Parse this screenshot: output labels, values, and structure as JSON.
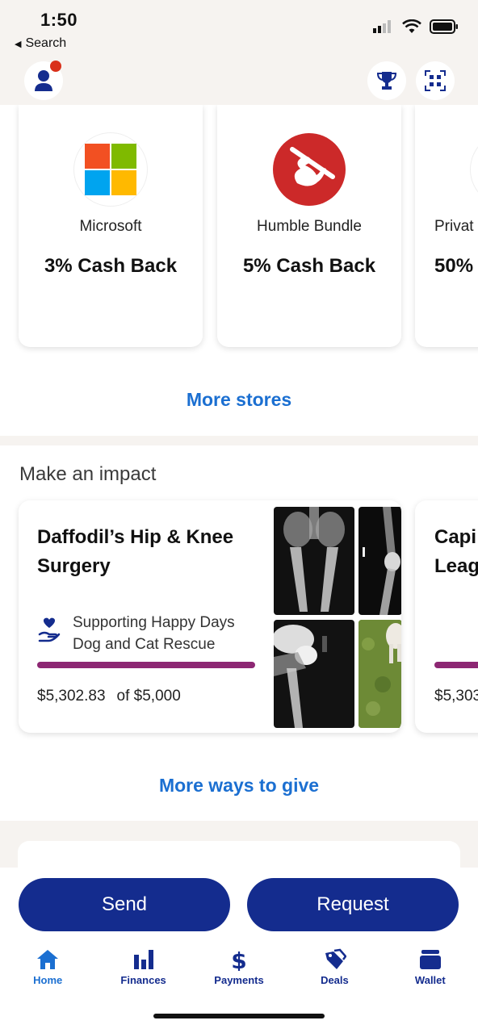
{
  "status": {
    "time": "1:50",
    "back_label": "Search"
  },
  "stores": [
    {
      "name": "Microsoft",
      "cashback": "3% Cash Back",
      "logo": "microsoft-logo"
    },
    {
      "name": "Humble Bundle",
      "cashback": "5% Cash Back",
      "logo": "humble-bundle-logo"
    },
    {
      "name": "Privat",
      "cashback": "50%",
      "logo": ""
    }
  ],
  "more_stores": "More stores",
  "impact": {
    "section_title": "Make an impact",
    "cards": [
      {
        "title": "Daffodil’s Hip & Knee Surgery",
        "org": "Supporting Happy Days Dog and Cat Rescue",
        "raised": "$5,302.83",
        "goal": "of $5,000",
        "progress": 1.0
      },
      {
        "title": "Capi Leag",
        "raised": "$5,303",
        "progress": 1.0
      }
    ],
    "more_link": "More ways to give"
  },
  "actions": {
    "send": "Send",
    "request": "Request"
  },
  "tabs": [
    {
      "label": "Home",
      "icon": "home-icon"
    },
    {
      "label": "Finances",
      "icon": "finances-icon"
    },
    {
      "label": "Payments",
      "icon": "dollar-icon"
    },
    {
      "label": "Deals",
      "icon": "deals-icon"
    },
    {
      "label": "Wallet",
      "icon": "wallet-icon"
    }
  ],
  "colors": {
    "brand_navy": "#142c8e",
    "link_blue": "#1b6fd1",
    "progress_purple": "#8d2773",
    "notification_red": "#d9301a"
  }
}
